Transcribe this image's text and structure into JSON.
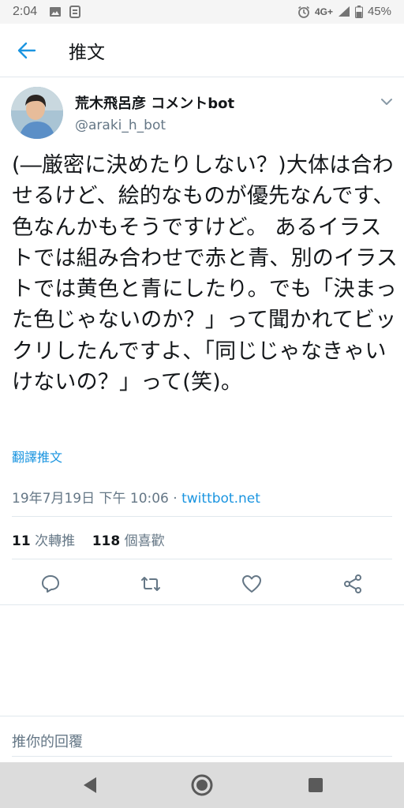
{
  "status_bar": {
    "time": "2:04",
    "network": "4G+",
    "battery": "45%",
    "icons": [
      "image-icon",
      "notification-icon",
      "alarm-icon",
      "signal-icon",
      "battery-icon"
    ]
  },
  "header": {
    "title": "推文",
    "back_icon": "arrow-left-icon"
  },
  "tweet": {
    "author_name": "荒木飛呂彦 コメントbot",
    "handle": "@araki_h_bot",
    "text": "(―厳密に決めたりしない？)大体は合わせるけど、絵的なものが優先なんです、色なんかもそうですけど。 あるイラストでは組み合わせで赤と青、別のイラストでは黄色と青にしたり。でも「決まった色じゃないのか？」って聞かれてビックリしたんですよ、「同じじゃなきゃいけないの？」って(笑)。",
    "translate_label": "翻譯推文",
    "timestamp": "19年7月19日 下午 10:06",
    "separator": " · ",
    "source": "twittbot.net",
    "retweets_count": "11",
    "retweets_label": "次轉推",
    "likes_count": "118",
    "likes_label": "個喜歡"
  },
  "actions": [
    "reply-icon",
    "retweet-icon",
    "like-icon",
    "share-icon"
  ],
  "reply_box": {
    "placeholder": "推你的回覆"
  },
  "nav_bar": {
    "buttons": [
      "back-triangle",
      "home-circle",
      "recents-square"
    ]
  },
  "colors": {
    "accent": "#1b95e0",
    "text": "#14171a",
    "secondary": "#657786",
    "divider": "#e1e8ed"
  }
}
